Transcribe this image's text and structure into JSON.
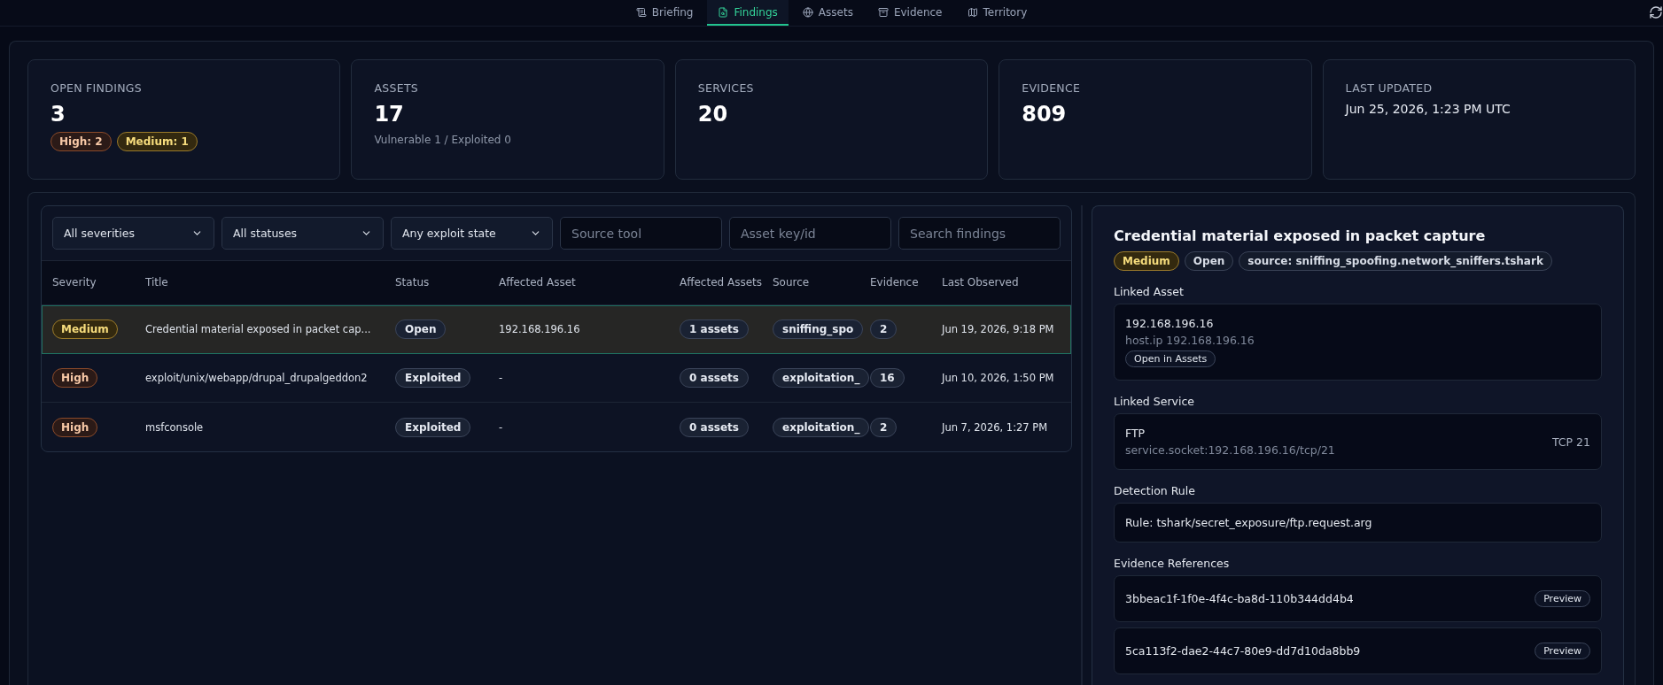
{
  "nav": {
    "tabs": [
      {
        "label": "Briefing",
        "selected": false
      },
      {
        "label": "Findings",
        "selected": true
      },
      {
        "label": "Assets",
        "selected": false
      },
      {
        "label": "Evidence",
        "selected": false
      },
      {
        "label": "Territory",
        "selected": false
      }
    ]
  },
  "stats": [
    {
      "label": "OPEN FINDINGS",
      "value": "3",
      "badges": [
        {
          "label": "High: 2",
          "kind": "high"
        },
        {
          "label": "Medium: 1",
          "kind": "medium"
        }
      ]
    },
    {
      "label": "ASSETS",
      "value": "17",
      "note": "Vulnerable 1 / Exploited 0"
    },
    {
      "label": "SERVICES",
      "value": "20"
    },
    {
      "label": "EVIDENCE",
      "value": "809"
    },
    {
      "label": "LAST UPDATED",
      "text": "Jun 25, 2026, 1:23 PM UTC"
    }
  ],
  "filters": {
    "selects": [
      "All severities",
      "All statuses",
      "Any exploit state"
    ],
    "inputs": [
      {
        "placeholder": "Source tool"
      },
      {
        "placeholder": "Asset key/id"
      },
      {
        "placeholder": "Search findings"
      }
    ]
  },
  "table": {
    "columns": [
      "Severity",
      "Title",
      "Status",
      "Affected Asset",
      "Affected Assets",
      "Source",
      "Evidence",
      "Last Observed"
    ],
    "rows": [
      {
        "severity": {
          "label": "Medium",
          "kind": "medium"
        },
        "title": "Credential material exposed in packet cap...",
        "status": "Open",
        "affected_asset": "192.168.196.16",
        "affected_assets": "1 assets",
        "source": "sniffing_spo",
        "evidence": "2",
        "last_observed": "Jun 19, 2026, 9:18 PM",
        "selected": true
      },
      {
        "severity": {
          "label": "High",
          "kind": "high"
        },
        "title": "exploit/unix/webapp/drupal_drupalgeddon2",
        "status": "Exploited",
        "affected_asset": "-",
        "affected_assets": "0 assets",
        "source": "exploitation_",
        "evidence": "16",
        "last_observed": "Jun 10, 2026, 1:50 PM",
        "selected": false
      },
      {
        "severity": {
          "label": "High",
          "kind": "high"
        },
        "title": "msfconsole",
        "status": "Exploited",
        "affected_asset": "-",
        "affected_assets": "0 assets",
        "source": "exploitation_",
        "evidence": "2",
        "last_observed": "Jun 7, 2026, 1:27 PM",
        "selected": false
      }
    ]
  },
  "detail": {
    "title": "Credential material exposed in packet capture",
    "badges": [
      {
        "label": "Medium",
        "kind": "medium"
      },
      {
        "label": "Open",
        "kind": "plain"
      },
      {
        "label": "source: sniffing_spoofing.network_sniffers.tshark",
        "kind": "plain"
      }
    ],
    "linked_asset": {
      "heading": "Linked Asset",
      "name": "192.168.196.16",
      "sub": "host.ip 192.168.196.16",
      "button": "Open in Assets"
    },
    "linked_service": {
      "heading": "Linked Service",
      "name": "FTP",
      "sub": "service.socket:192.168.196.16/tcp/21",
      "port": "TCP 21"
    },
    "detection_rule": {
      "heading": "Detection Rule",
      "text": "Rule: tshark/secret_exposure/ftp.request.arg"
    },
    "evidence_refs": {
      "heading": "Evidence References",
      "items": [
        {
          "id": "3bbeac1f-1f0e-4f4c-ba8d-110b344dd4b4",
          "button": "Preview"
        },
        {
          "id": "5ca113f2-dae2-44c7-80e9-dd7d10da8bb9",
          "button": "Preview"
        }
      ]
    }
  }
}
